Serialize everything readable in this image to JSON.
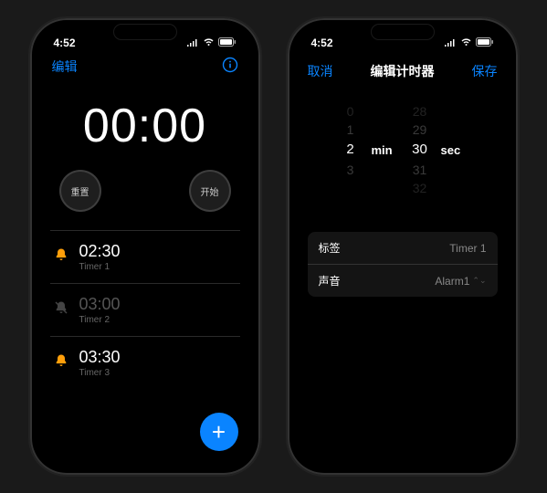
{
  "status": {
    "time": "4:52"
  },
  "left": {
    "edit": "编辑",
    "big_time": "00:00",
    "reset": "重置",
    "start": "开始",
    "timers": [
      {
        "time": "02:30",
        "label": "Timer 1",
        "active": true
      },
      {
        "time": "03:00",
        "label": "Timer 2",
        "active": false
      },
      {
        "time": "03:30",
        "label": "Timer 3",
        "active": true
      }
    ]
  },
  "right": {
    "cancel": "取消",
    "title": "编辑计时器",
    "save": "保存",
    "picker": {
      "min": {
        "above2": "0",
        "above1": "1",
        "sel": "2",
        "below1": "3",
        "unit": "min"
      },
      "sec": {
        "above2": "28",
        "above1": "29",
        "sel": "30",
        "below1": "31",
        "below2": "32",
        "unit": "sec"
      }
    },
    "rows": {
      "label_key": "标签",
      "label_val": "Timer 1",
      "sound_key": "声音",
      "sound_val": "Alarm1"
    }
  },
  "colors": {
    "accent": "#0a84ff",
    "bell_active": "#ff9f0a",
    "bell_muted": "#555555"
  }
}
